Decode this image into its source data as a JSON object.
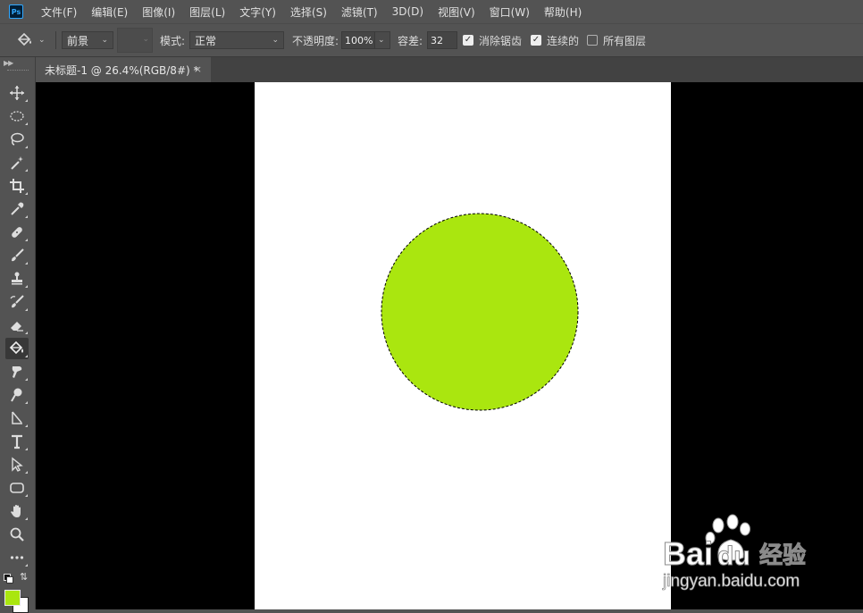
{
  "app": {
    "logo": "Ps"
  },
  "menu": [
    "文件(F)",
    "编辑(E)",
    "图像(I)",
    "图层(L)",
    "文字(Y)",
    "选择(S)",
    "滤镜(T)",
    "3D(D)",
    "视图(V)",
    "窗口(W)",
    "帮助(H)"
  ],
  "options": {
    "tool_icon": "paint-bucket-icon",
    "fill_source": "前景",
    "mode_label": "模式:",
    "mode_value": "正常",
    "opacity_label": "不透明度:",
    "opacity_value": "100%",
    "tolerance_label": "容差:",
    "tolerance_value": "32",
    "antialias_label": "消除锯齿",
    "antialias_checked": true,
    "contiguous_label": "连续的",
    "contiguous_checked": true,
    "all_layers_label": "所有图层",
    "all_layers_checked": false
  },
  "document_tab": {
    "title": "未标题-1 @ 26.4%(RGB/8#) *",
    "close": "×"
  },
  "toolbar": {
    "tools": [
      "move-tool",
      "marquee-tool",
      "lasso-tool",
      "magic-wand-tool",
      "crop-tool",
      "eyedropper-tool",
      "healing-brush-tool",
      "brush-tool",
      "stamp-tool",
      "history-brush-tool",
      "eraser-tool",
      "paint-bucket-tool",
      "smudge-tool",
      "dodge-tool",
      "pen-tool",
      "type-tool",
      "path-selection-tool",
      "rectangle-tool",
      "hand-tool",
      "zoom-tool",
      "more-tools"
    ],
    "active_tool": "paint-bucket-tool",
    "foreground_color": "#aae60f",
    "background_color": "#ffffff"
  },
  "canvas": {
    "fill_color": "#aae60f",
    "selection": "dashed-circle"
  },
  "watermark": {
    "brand_text": "Bai",
    "brand_text2": "du",
    "brand_cn": "经验",
    "url": "jingyan.baidu.com"
  }
}
